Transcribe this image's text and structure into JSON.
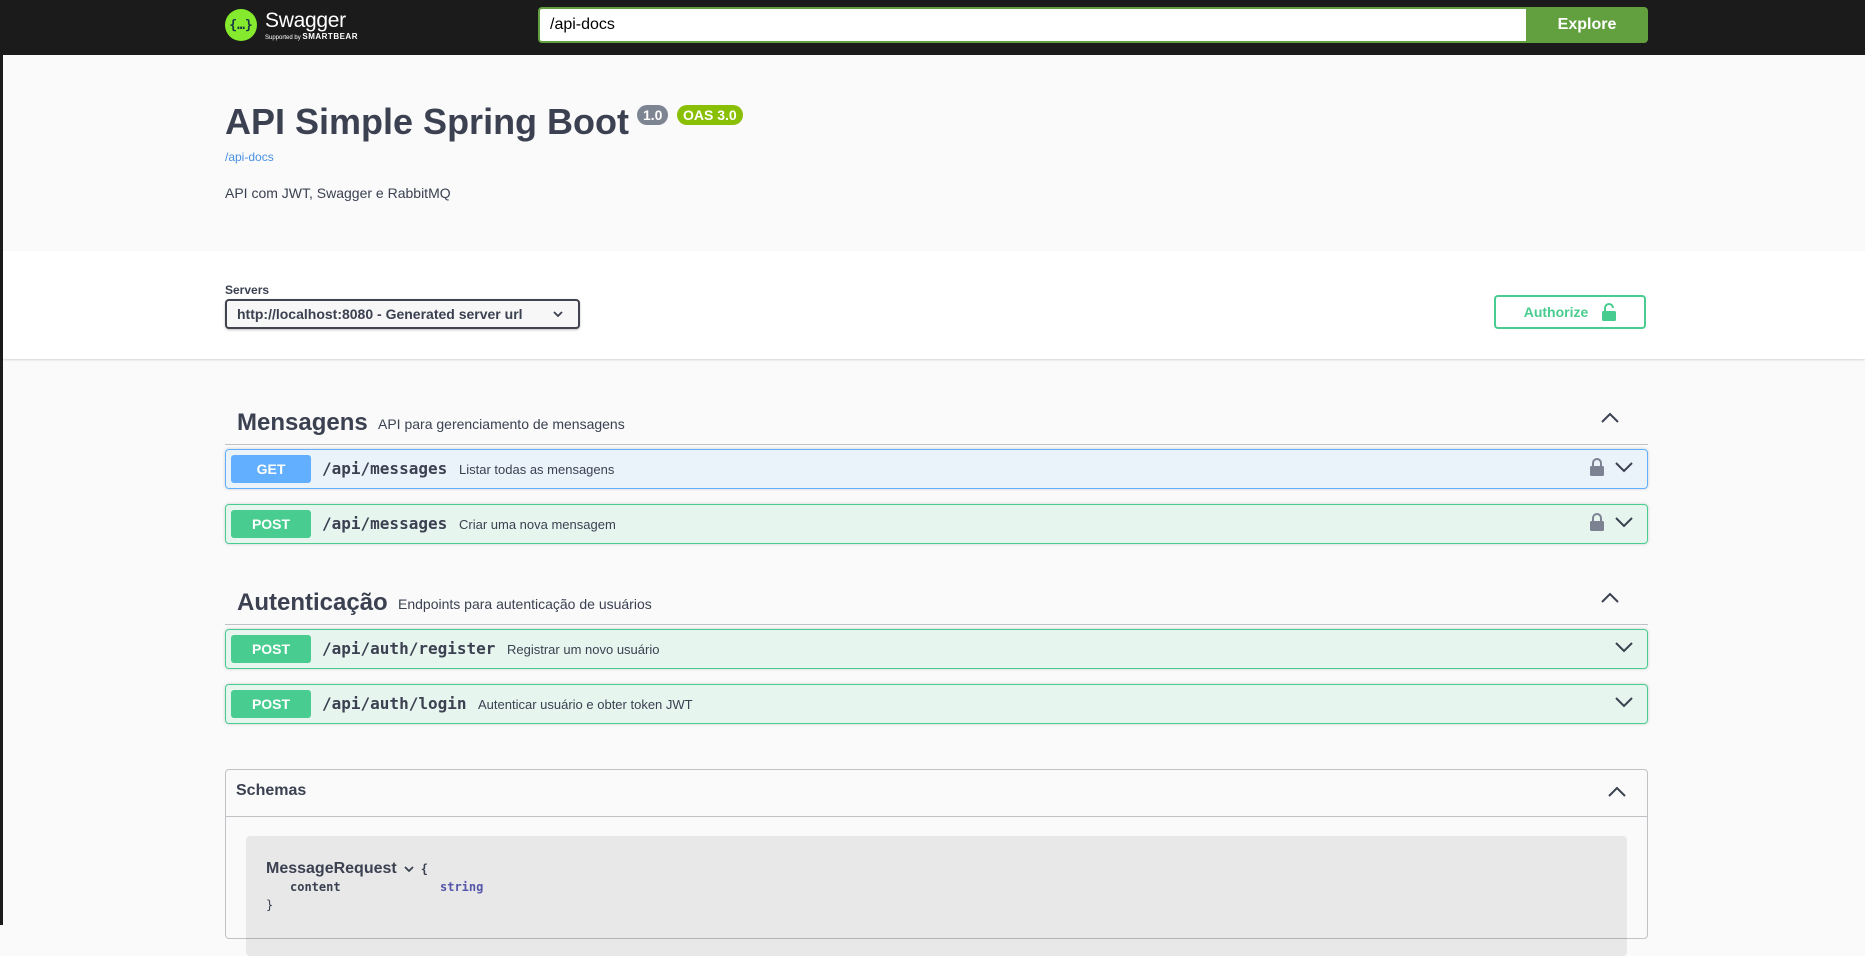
{
  "topbar": {
    "logo_name": "Swagger",
    "logo_supported": "Supported by",
    "logo_brand": "SMARTBEAR",
    "url_value": "/api-docs",
    "explore_label": "Explore"
  },
  "info": {
    "title": "API Simple Spring Boot",
    "version": "1.0",
    "oas": "OAS 3.0",
    "link": "/api-docs",
    "description": "API com JWT, Swagger e RabbitMQ"
  },
  "servers": {
    "label": "Servers",
    "selected": "http://localhost:8080 - Generated server url",
    "authorize_label": "Authorize"
  },
  "tags": [
    {
      "name": "Mensagens",
      "description": "API para gerenciamento de mensagens",
      "operations": [
        {
          "method": "GET",
          "path": "/api/messages",
          "summary": "Listar todas as mensagens",
          "locked": true
        },
        {
          "method": "POST",
          "path": "/api/messages",
          "summary": "Criar uma nova mensagem",
          "locked": true
        }
      ]
    },
    {
      "name": "Autenticação",
      "description": "Endpoints para autenticação de usuários",
      "operations": [
        {
          "method": "POST",
          "path": "/api/auth/register",
          "summary": "Registrar um novo usuário",
          "locked": false
        },
        {
          "method": "POST",
          "path": "/api/auth/login",
          "summary": "Autenticar usuário e obter token JWT",
          "locked": false
        }
      ]
    }
  ],
  "schemas": {
    "title": "Schemas",
    "models": [
      {
        "name": "MessageRequest",
        "open_brace": "{",
        "close_brace": "}",
        "properties": [
          {
            "name": "content",
            "type": "string"
          }
        ]
      }
    ]
  },
  "colors": {
    "get": "#61affe",
    "post": "#49cc90",
    "topbar": "#1b1b1b",
    "explore": "#62a03f"
  },
  "icons": [
    "swagger-logo-icon",
    "chevron-down-icon",
    "lock-icon",
    "chevron-up-icon"
  ]
}
